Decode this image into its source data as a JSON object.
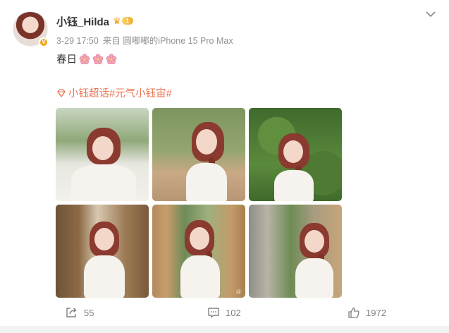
{
  "author": {
    "name": "小钰_Hilda",
    "vip_level": "1",
    "verified_badge": "V"
  },
  "meta": {
    "timestamp": "3-29 17:50",
    "source": "来自 圆嘟嘟的iPhone 15 Pro Max"
  },
  "post": {
    "text": "春日",
    "emoji_icons": [
      "cherry-blossom-icon",
      "cherry-blossom-icon",
      "cherry-blossom-icon"
    ],
    "topics": "小钰超话#元气小钰宙#"
  },
  "photos": [
    {
      "name": "photo-1"
    },
    {
      "name": "photo-2"
    },
    {
      "name": "photo-3"
    },
    {
      "name": "photo-4"
    },
    {
      "name": "photo-5"
    },
    {
      "name": "photo-6"
    }
  ],
  "actions": {
    "repost_count": "55",
    "comment_count": "102",
    "like_count": "1972"
  },
  "colors": {
    "topic": "#eb7350",
    "meta": "#939393",
    "vip": "#f2ae2b"
  }
}
